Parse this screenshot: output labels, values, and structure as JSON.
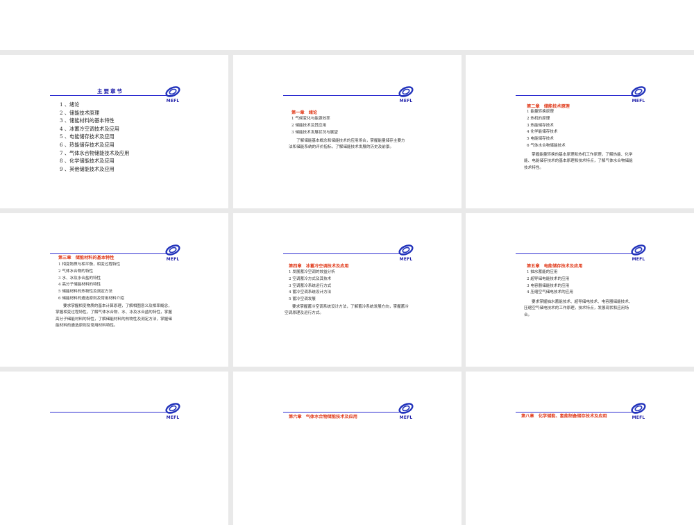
{
  "slides": [
    {
      "title": "主要章节",
      "items": [
        "1 、绪论",
        "2 、储能技术原理",
        "3 、储能材料的基本特性",
        "4 、冰蓄冷空调技术及应用",
        "5 、电能储存技术及应用",
        "6 、热能储存技术及应用",
        "7 、气体水合物储能技术及应用",
        "8 、化学储能技术及应用",
        "9 、其他储能技术及应用"
      ]
    },
    {
      "heading": "第一章　绪论",
      "items": [
        "1  气候变化与能源效率",
        "2 储能技术及其应用",
        "3 储能技术发展状况与展望"
      ],
      "para": "了解储能基本概念和储能技术的应用场合，掌握能量储存主要方法和储能系统的评价指标，了解储能技术发展的历史及前景。"
    },
    {
      "heading": "第二章　储能技术原理",
      "items": [
        "1  能量转换原理",
        "2  热机的原理",
        "3  热能储存技术",
        "4  化学能储存技术",
        "5  电能储存技术",
        "6  气体水合物储能技术"
      ],
      "para": "掌握能量转换的基本原理和热机工作原理，了解热能、化学能、电能储存技术的基本原理和技术特点，了解气体水合物储能技术特性。"
    },
    {
      "heading": "第三章　储能材料的基本特性",
      "items": [
        "1  相变物质与相平衡，相变过程特性",
        "  2 气体水合物的特性",
        "3 水、冰及水合盐的特性",
        "4  高分子储能材料的特性",
        "5 储能材料的热物性及测定方法",
        "6 储能材料的遴选原则及常用材料介绍"
      ],
      "para": "要求掌握相变物质的基本计算原理，了解相图意义及相率概念，掌握相变过程特性，了解气体水合物、水、冰及水合盐的特性，掌握高分子储能材料的特性，了解储能材料的热物性及测定方法，掌握储能材料的遴选原则及常用材料特性。"
    },
    {
      "heading": "第四章　冰蓄冷空调技术及应用",
      "items": [
        "1  发展蓄冷空调的效益分析",
        "2  空调蓄冷方式及其技术",
        "3  空调蓄冷系统运行方式",
        "4  蓄冷空调系统设计方法",
        "5  蓄冷空调发展"
      ],
      "para": "要求掌握蓄冷空调系统设计方法，了解蓄冷系统发展方向，掌握蓄冷空调原理及运行方式。"
    },
    {
      "heading": "第五章　电能储存技术及应用",
      "items": [
        "1  抽水蓄能的应用",
        "2  超导储电能技术的应用",
        "3  电容器储能技术的应用",
        "4  压缩空气储电技术的应用"
      ],
      "para": "要求掌握抽水蓄能技术、超导储电技术、电容器储能技术、压缩空气储电技术的工作原理，技术特点，发展现状和应用场合。"
    },
    {
      "heading": "第六章　气体水合物储能技术及应用"
    },
    {
      "heading": ""
    },
    {
      "heading": "第八章　化学储能、氢能制备储存技术及应用"
    }
  ],
  "logo": {
    "text": "MEFL",
    "icon": "mefl-logo-icon"
  },
  "colors": {
    "accent": "#2a2ad0",
    "heading": "#e03a1a",
    "background": "#e9e9e9"
  }
}
